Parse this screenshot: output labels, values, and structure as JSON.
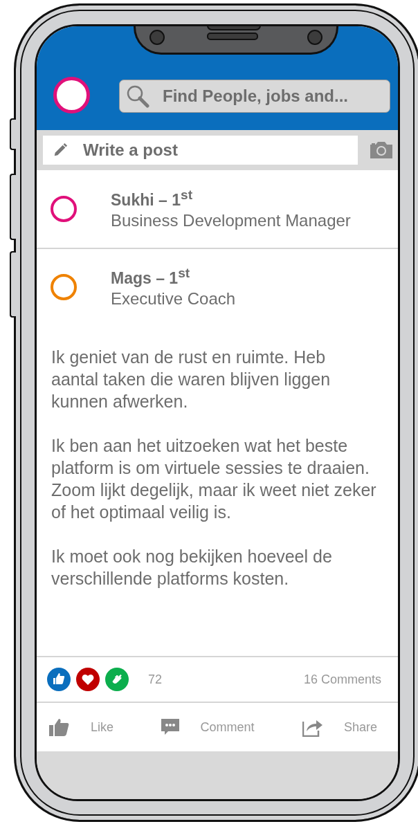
{
  "header": {
    "avatar": {
      "color": "#e0107a"
    },
    "search": {
      "placeholder": "Find People, jobs and..."
    }
  },
  "composer": {
    "placeholder": "Write a post"
  },
  "contacts": [
    {
      "name": "Sukhi – 1$^{st}$",
      "title": "Business Development Manager",
      "color": "#e0107a"
    },
    {
      "name": "Mags – 1$^{st}$",
      "title": "Executive Coach",
      "color": "#ef8200"
    }
  ],
  "post": {
    "paragraphs": [
      "Ik geniet van de rust en ruimte. Heb aantal taken die waren blijven liggen kunnen afwerken.",
      "Ik ben aan het uitzoeken wat het beste platform is om virtuele sessies te draaien. Zoom lijkt degelijk, maar ik weet niet zeker of het optimaal veilig is.",
      "Ik moet ook nog bekijken hoeveel de verschillende platforms kosten."
    ]
  },
  "reactions": [
    {
      "kind": "like",
      "color": "#0a6ebd"
    },
    {
      "kind": "love",
      "color": "#c00000"
    },
    {
      "kind": "clap",
      "color": "#0cae4d"
    }
  ],
  "reaction_count": "72",
  "comment_count": "16 Comments",
  "actions": [
    {
      "kind": "like",
      "label": "Like"
    },
    {
      "kind": "comment",
      "label": "Comment"
    },
    {
      "kind": "share",
      "label": "Share"
    }
  ]
}
